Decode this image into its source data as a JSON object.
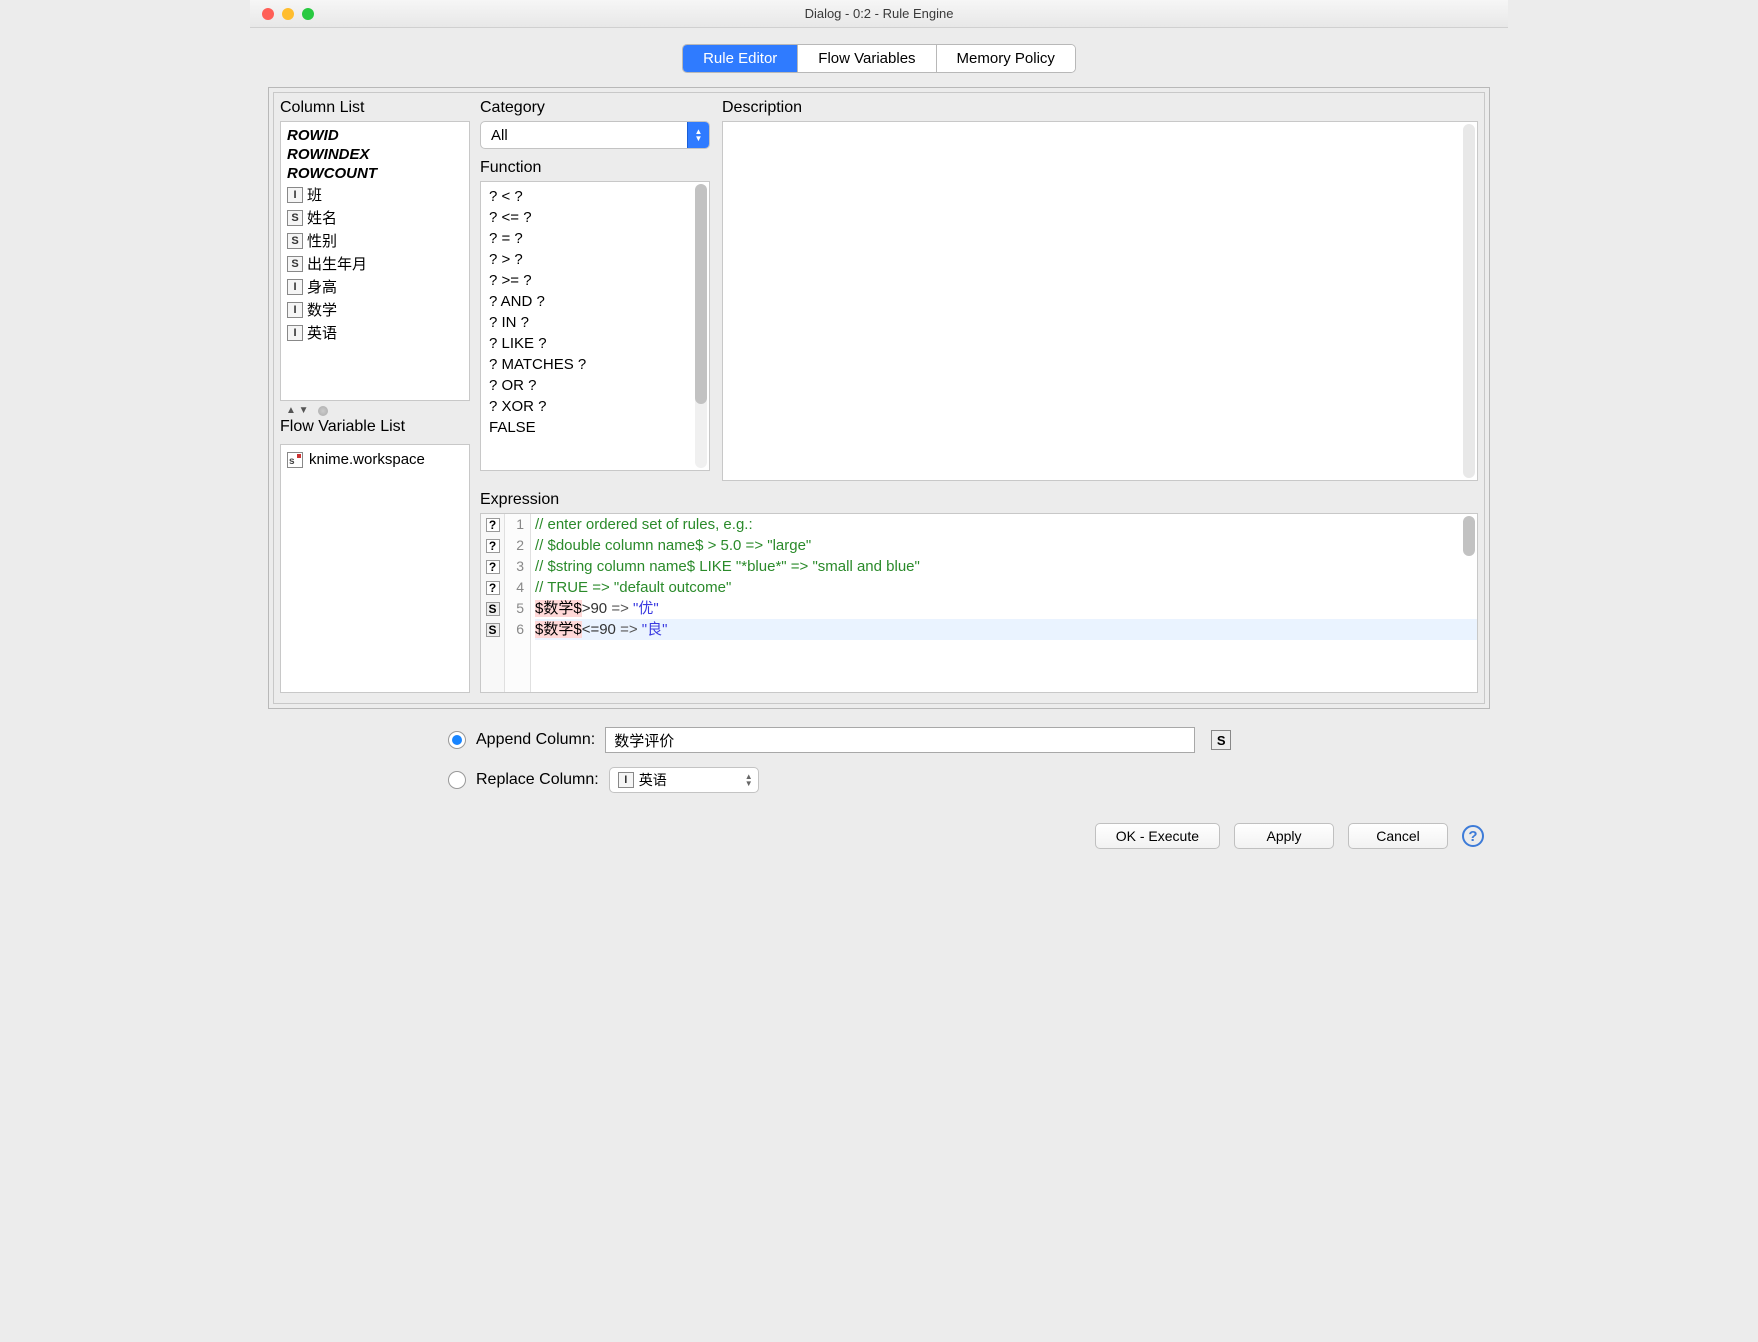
{
  "window": {
    "title": "Dialog - 0:2 - Rule Engine"
  },
  "tabs": [
    {
      "label": "Rule Editor",
      "active": true
    },
    {
      "label": "Flow Variables",
      "active": false
    },
    {
      "label": "Memory Policy",
      "active": false
    }
  ],
  "column_list": {
    "header": "Column List",
    "builtin": [
      "ROWID",
      "ROWINDEX",
      "ROWCOUNT"
    ],
    "columns": [
      {
        "type": "I",
        "name": "班"
      },
      {
        "type": "S",
        "name": "姓名"
      },
      {
        "type": "S",
        "name": "性别"
      },
      {
        "type": "S",
        "name": "出生年月"
      },
      {
        "type": "I",
        "name": "身高"
      },
      {
        "type": "I",
        "name": "数学"
      },
      {
        "type": "I",
        "name": "英语"
      }
    ]
  },
  "flow_variables": {
    "header": "Flow Variable List",
    "items": [
      {
        "name": "knime.workspace"
      }
    ]
  },
  "category": {
    "label": "Category",
    "selected": "All"
  },
  "description": {
    "label": "Description"
  },
  "function": {
    "label": "Function",
    "items": [
      "? < ?",
      "? <= ?",
      "? = ?",
      "? > ?",
      "? >= ?",
      "? AND ?",
      "? IN ?",
      "? LIKE ?",
      "? MATCHES ?",
      "? OR ?",
      "? XOR ?",
      "FALSE"
    ]
  },
  "expression": {
    "label": "Expression",
    "lines": [
      {
        "n": 1,
        "gutter": "?",
        "type": "comment",
        "text": "// enter ordered set of rules, e.g.:"
      },
      {
        "n": 2,
        "gutter": "?",
        "type": "comment",
        "text": "// $double column name$ > 5.0 => \"large\""
      },
      {
        "n": 3,
        "gutter": "?",
        "type": "comment",
        "text": "// $string column name$ LIKE \"*blue*\" => \"small and blue\""
      },
      {
        "n": 4,
        "gutter": "?",
        "type": "comment",
        "text": "// TRUE => \"default outcome\""
      },
      {
        "n": 5,
        "gutter": "S",
        "type": "rule",
        "var": "$数学$",
        "op": ">90 ",
        "arrow": "=>",
        "str": " \"优\""
      },
      {
        "n": 6,
        "gutter": "S",
        "type": "rule",
        "var": "$数学$",
        "op": "<=90 ",
        "arrow": "=>",
        "str": " \"良\"",
        "highlight": true
      }
    ]
  },
  "output": {
    "append": {
      "label": "Append Column:",
      "value": "数学评价",
      "type_badge": "S",
      "selected": true
    },
    "replace": {
      "label": "Replace Column:",
      "value": "英语",
      "type_badge": "I",
      "selected": false
    }
  },
  "buttons": {
    "ok": "OK - Execute",
    "apply": "Apply",
    "cancel": "Cancel"
  }
}
